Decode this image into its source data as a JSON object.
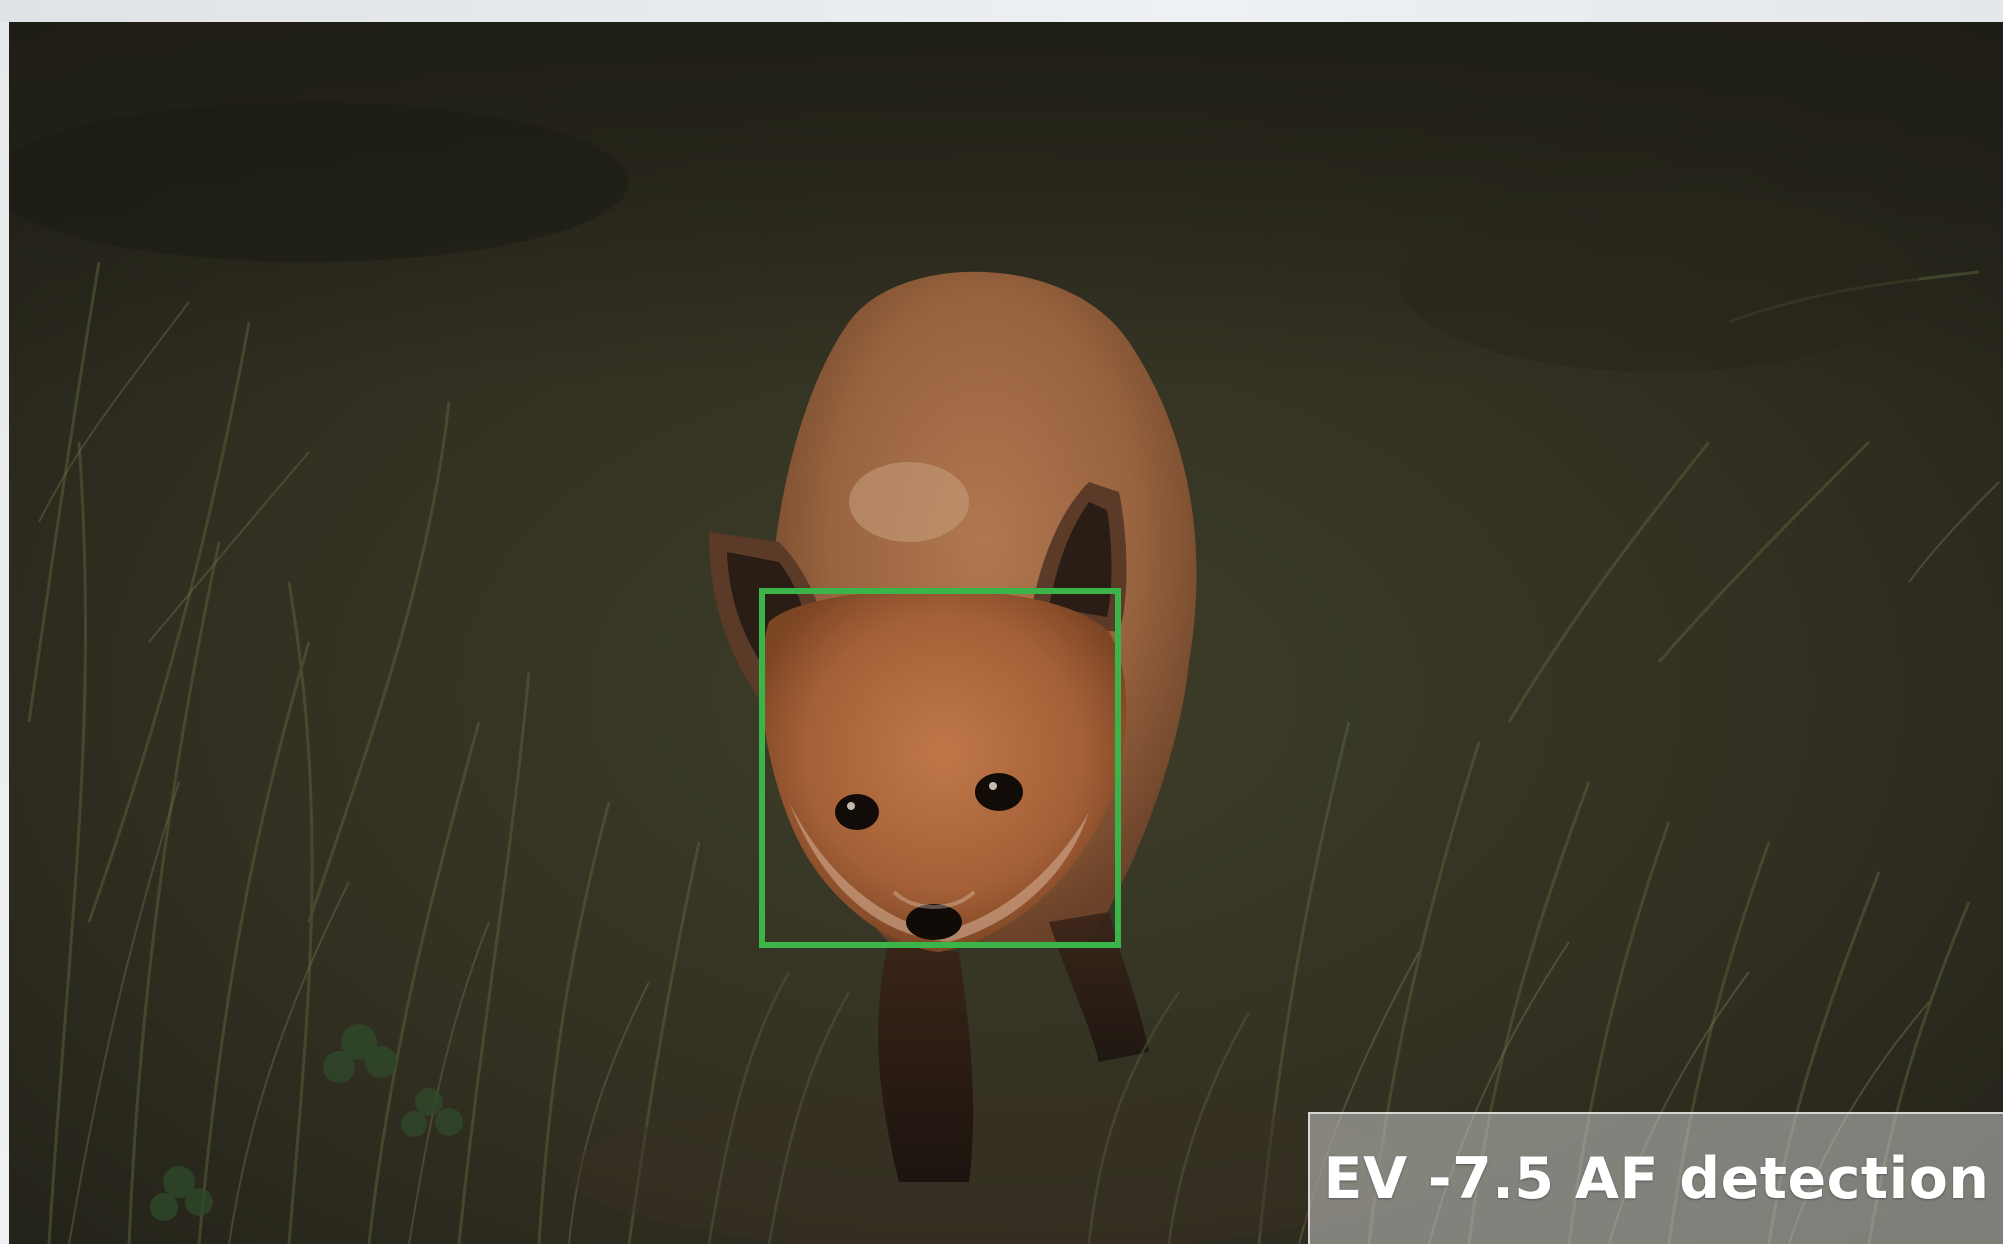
{
  "caption": {
    "text": "EV -7.5 AF detection"
  },
  "overlay": {
    "af_frame_color": "#3bb44a",
    "af_frame_label": "subject-eye-face-detection-frame"
  },
  "scene": {
    "subject": "fox-kit",
    "background": "grass"
  },
  "colors": {
    "grass_dark": "#2b2a1c",
    "grass_green": "#3a4526",
    "fox_fur": "#a8643a",
    "caption_bg": "#c8cac8"
  }
}
